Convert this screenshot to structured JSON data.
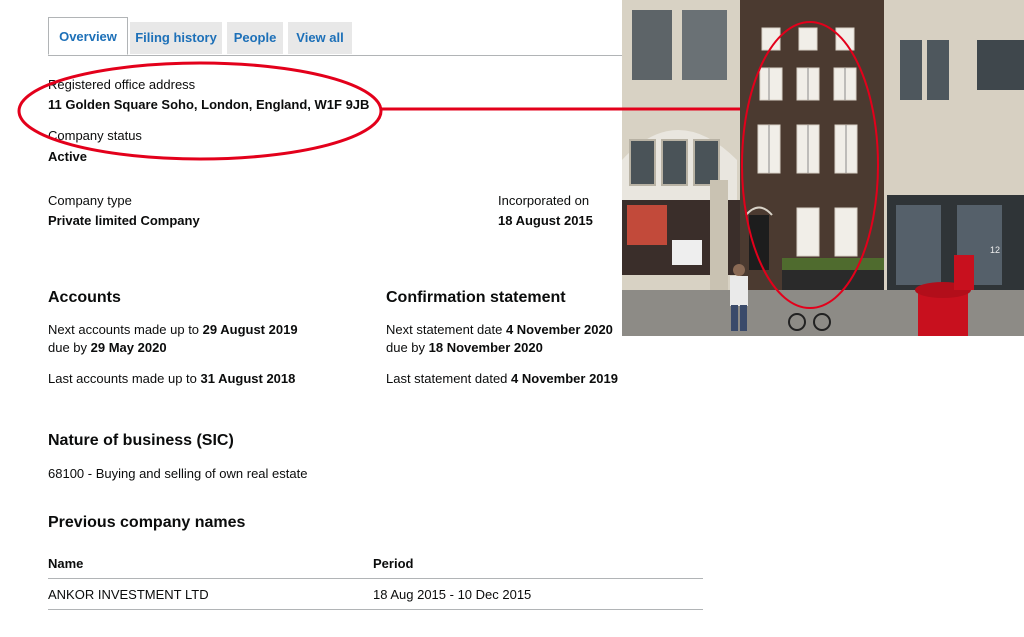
{
  "tabs": [
    {
      "label": "Overview"
    },
    {
      "label": "Filing history"
    },
    {
      "label": "People"
    },
    {
      "label": "View all"
    }
  ],
  "registered_office": {
    "label": "Registered office address",
    "value": "11 Golden Square Soho, London, England, W1F 9JB"
  },
  "company_status": {
    "label": "Company status",
    "value": "Active"
  },
  "company_type": {
    "label": "Company type",
    "value": "Private limited Company"
  },
  "incorporated": {
    "label": "Incorporated on",
    "value": "18 August 2015"
  },
  "accounts": {
    "heading": "Accounts",
    "next_prefix": "Next accounts made up to ",
    "next_date": "29 August 2019",
    "due_prefix": "due by ",
    "due_date": "29 May 2020",
    "last_prefix": "Last accounts made up to ",
    "last_date": "31 August 2018"
  },
  "confirmation": {
    "heading": "Confirmation statement",
    "next_prefix": "Next statement date ",
    "next_date": "4 November 2020",
    "due_prefix": "due by ",
    "due_date": "18 November 2020",
    "last_prefix": "Last statement dated ",
    "last_date": "4 November 2019"
  },
  "nature": {
    "heading": "Nature of business (SIC)",
    "value": "68100 - Buying and selling of own real estate"
  },
  "previous_names": {
    "heading": "Previous company names",
    "columns": [
      "Name",
      "Period"
    ],
    "rows": [
      {
        "name": "ANKOR INVESTMENT LTD",
        "period": "18 Aug 2015 - 10 Dec 2015"
      }
    ]
  },
  "photo": {
    "building_number": "12"
  },
  "colors": {
    "link": "#1d70b8",
    "annotation": "#e3001b",
    "tab_bg": "#e8e8e8"
  }
}
